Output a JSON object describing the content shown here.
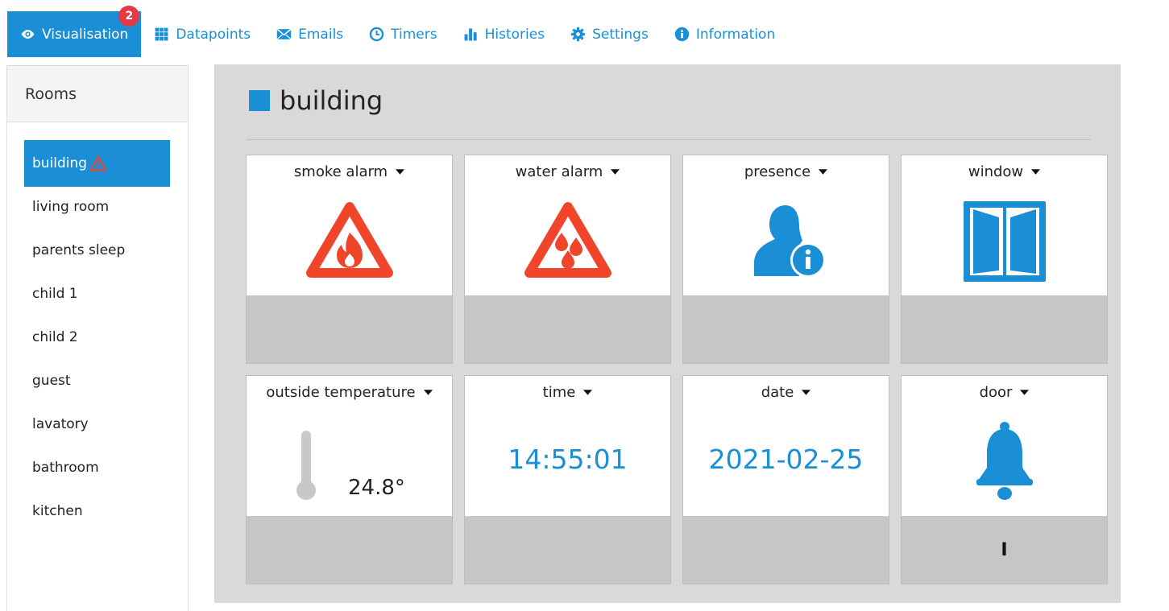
{
  "nav": {
    "items": [
      {
        "label": "Visualisation",
        "icon": "eye-icon",
        "active": true,
        "badge": "2"
      },
      {
        "label": "Datapoints",
        "icon": "grid-icon"
      },
      {
        "label": "Emails",
        "icon": "envelope-icon"
      },
      {
        "label": "Timers",
        "icon": "clock-icon"
      },
      {
        "label": "Histories",
        "icon": "bar-chart-icon"
      },
      {
        "label": "Settings",
        "icon": "gear-icon"
      },
      {
        "label": "Information",
        "icon": "info-icon"
      }
    ]
  },
  "sidebar": {
    "title": "Rooms",
    "rooms": [
      {
        "label": "building",
        "active": true,
        "warning": true
      },
      {
        "label": "living room"
      },
      {
        "label": "parents sleep"
      },
      {
        "label": "child 1"
      },
      {
        "label": "child 2"
      },
      {
        "label": "guest"
      },
      {
        "label": "lavatory"
      },
      {
        "label": "bathroom"
      },
      {
        "label": "kitchen"
      }
    ]
  },
  "main": {
    "title": "building",
    "tiles": [
      {
        "label": "smoke alarm",
        "icon": "fire-warning-icon"
      },
      {
        "label": "water alarm",
        "icon": "water-warning-icon"
      },
      {
        "label": "presence",
        "icon": "person-info-icon"
      },
      {
        "label": "window",
        "icon": "window-open-icon"
      },
      {
        "label": "outside temperature",
        "icon": "thermometer-icon",
        "value": "24.8°"
      },
      {
        "label": "time",
        "value": "14:55:01"
      },
      {
        "label": "date",
        "value": "2021-02-25"
      },
      {
        "label": "door",
        "icon": "bell-icon",
        "status": "I"
      }
    ]
  },
  "colors": {
    "accent": "#1a8fd6",
    "alarm": "#f0452b",
    "badge": "#e53946",
    "panel": "#d9d9d9",
    "tile_bottom": "#c6c6c6"
  }
}
